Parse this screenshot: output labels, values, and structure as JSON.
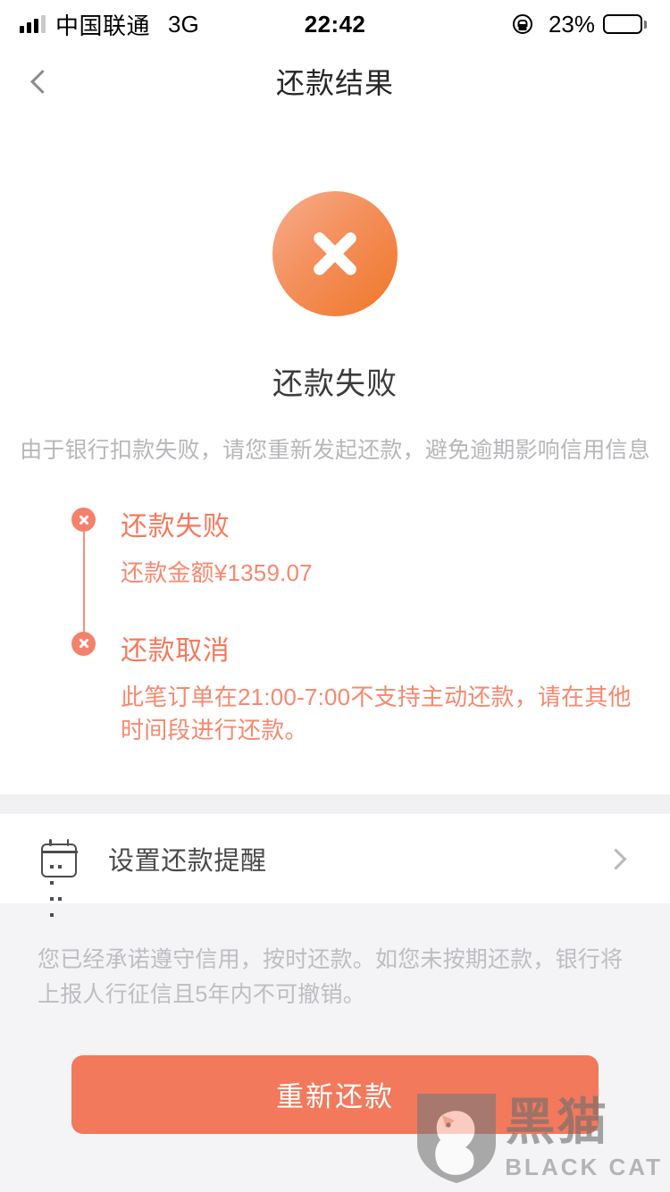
{
  "status_bar": {
    "carrier": "中国联通",
    "network": "3G",
    "time": "22:42",
    "battery_percent": "23%",
    "battery_level": 23,
    "icons": [
      "signal-bars-icon",
      "rotation-lock-icon",
      "location-arrow-icon",
      "battery-icon"
    ]
  },
  "nav": {
    "back_icon": "chevron-left-icon",
    "title": "还款结果"
  },
  "result": {
    "status_icon": "error-circle-x-icon",
    "title": "还款失败",
    "subtitle": "由于银行扣款失败，请您重新发起还款，避免逾期影响信用信息",
    "accent_color": "#f2795c",
    "icon_gradient_from": "#f7ad8c",
    "icon_gradient_to": "#ef7728"
  },
  "timeline": {
    "items": [
      {
        "icon": "error-dot-x-icon",
        "heading": "还款失败",
        "desc": "还款金额¥1359.07"
      },
      {
        "icon": "error-dot-x-icon",
        "heading": "还款取消",
        "desc": "此笔订单在21:00-7:00不支持主动还款，请在其他时间段进行还款。"
      }
    ]
  },
  "reminder": {
    "icon": "calendar-icon",
    "label": "设置还款提醒",
    "arrow_icon": "chevron-right-icon"
  },
  "disclaimer": {
    "text": "您已经承诺遵守信用，按时还款。如您未按期还款，银行将上报人行征信且5年内不可撤销。"
  },
  "action": {
    "primary_label": "重新还款"
  },
  "watermark": {
    "cn": "黑猫",
    "en": "BLACK CAT",
    "logo_icon": "black-cat-shield-icon"
  }
}
